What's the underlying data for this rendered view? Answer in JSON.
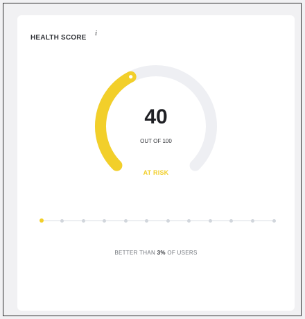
{
  "card": {
    "title": "HEALTH SCORE",
    "info_icon": "i"
  },
  "score": {
    "value": "40",
    "max_label": "OUT OF 100",
    "status": "AT RISK",
    "fraction": 0.4
  },
  "comparison": {
    "prefix": "BETTER THAN",
    "value": "3%",
    "suffix": "OF USERS"
  },
  "scale": {
    "steps": 12,
    "active_index": 0
  },
  "colors": {
    "accent": "#f2cf2a",
    "track": "#eeeff3"
  }
}
